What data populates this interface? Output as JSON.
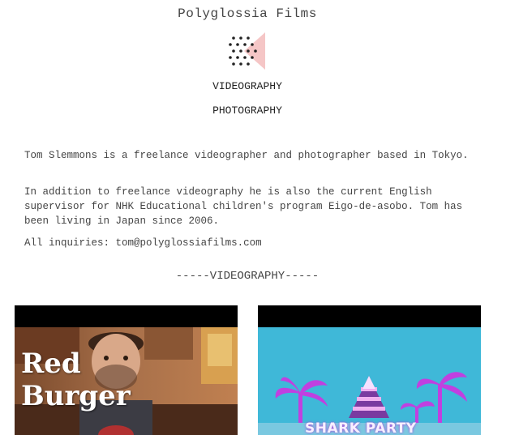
{
  "site": {
    "title": "Polyglossia Films"
  },
  "nav": {
    "videography": "VIDEOGRAPHY",
    "photography": "PHOTOGRAPHY"
  },
  "bio": {
    "paragraph_1": "Tom Slemmons is a freelance videographer and photographer based in Tokyo.",
    "paragraph_2": "In addition to freelance videography he is also the current English supervisor for NHK Educational children's program Eigo-de-asobo. Tom has been living in Japan since 2006.",
    "inquiries_label": "All inquiries:",
    "email": "tom@polyglossiafilms.com"
  },
  "section": {
    "videography_heading": "-----VIDEOGRAPHY-----"
  },
  "videos": [
    {
      "title_line_1": "Red",
      "title_line_2": "Burger"
    },
    {
      "title": "SHARK PARTY"
    }
  ],
  "colors": {
    "logo_triangle": "#f5c6c6",
    "logo_dots": "#222222",
    "shark_sky": "#3fb8d8",
    "shark_accent": "#c040e0"
  },
  "icons": {
    "logo": "dots-triangle-logo"
  }
}
